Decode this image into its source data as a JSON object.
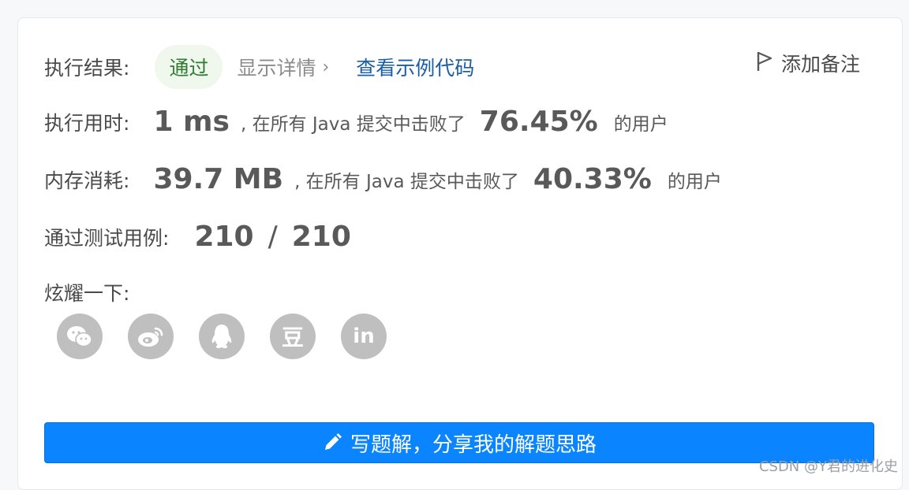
{
  "result": {
    "label": "执行结果:",
    "status": "通过",
    "details_link": "显示详情",
    "details_chevron": "›",
    "sample_code_link": "查看示例代码",
    "add_note": "添加备注"
  },
  "time": {
    "label": "执行用时:",
    "value": "1 ms",
    "beat_text": ", 在所有 Java 提交中击败了",
    "percent": "76.45%",
    "suffix": "的用户"
  },
  "memory": {
    "label": "内存消耗:",
    "value": "39.7 MB",
    "beat_text": ", 在所有 Java 提交中击败了",
    "percent": "40.33%",
    "suffix": "的用户"
  },
  "tests": {
    "label": "通过测试用例:",
    "passed": "210",
    "separator": "/",
    "total": "210"
  },
  "share": {
    "label": "炫耀一下:",
    "icons": [
      "wechat-icon",
      "weibo-icon",
      "qq-icon",
      "douban-icon",
      "linkedin-icon"
    ],
    "douban_glyph": "豆",
    "linkedin_glyph": "in"
  },
  "cta": {
    "label": "写题解，分享我的解题思路"
  },
  "watermark": "CSDN @Y君的进化史",
  "colors": {
    "accent_blue": "#0a84ff",
    "link_blue": "#1a5ea8",
    "pass_green": "#2e7d32",
    "icon_gray": "#bfbfbf"
  }
}
